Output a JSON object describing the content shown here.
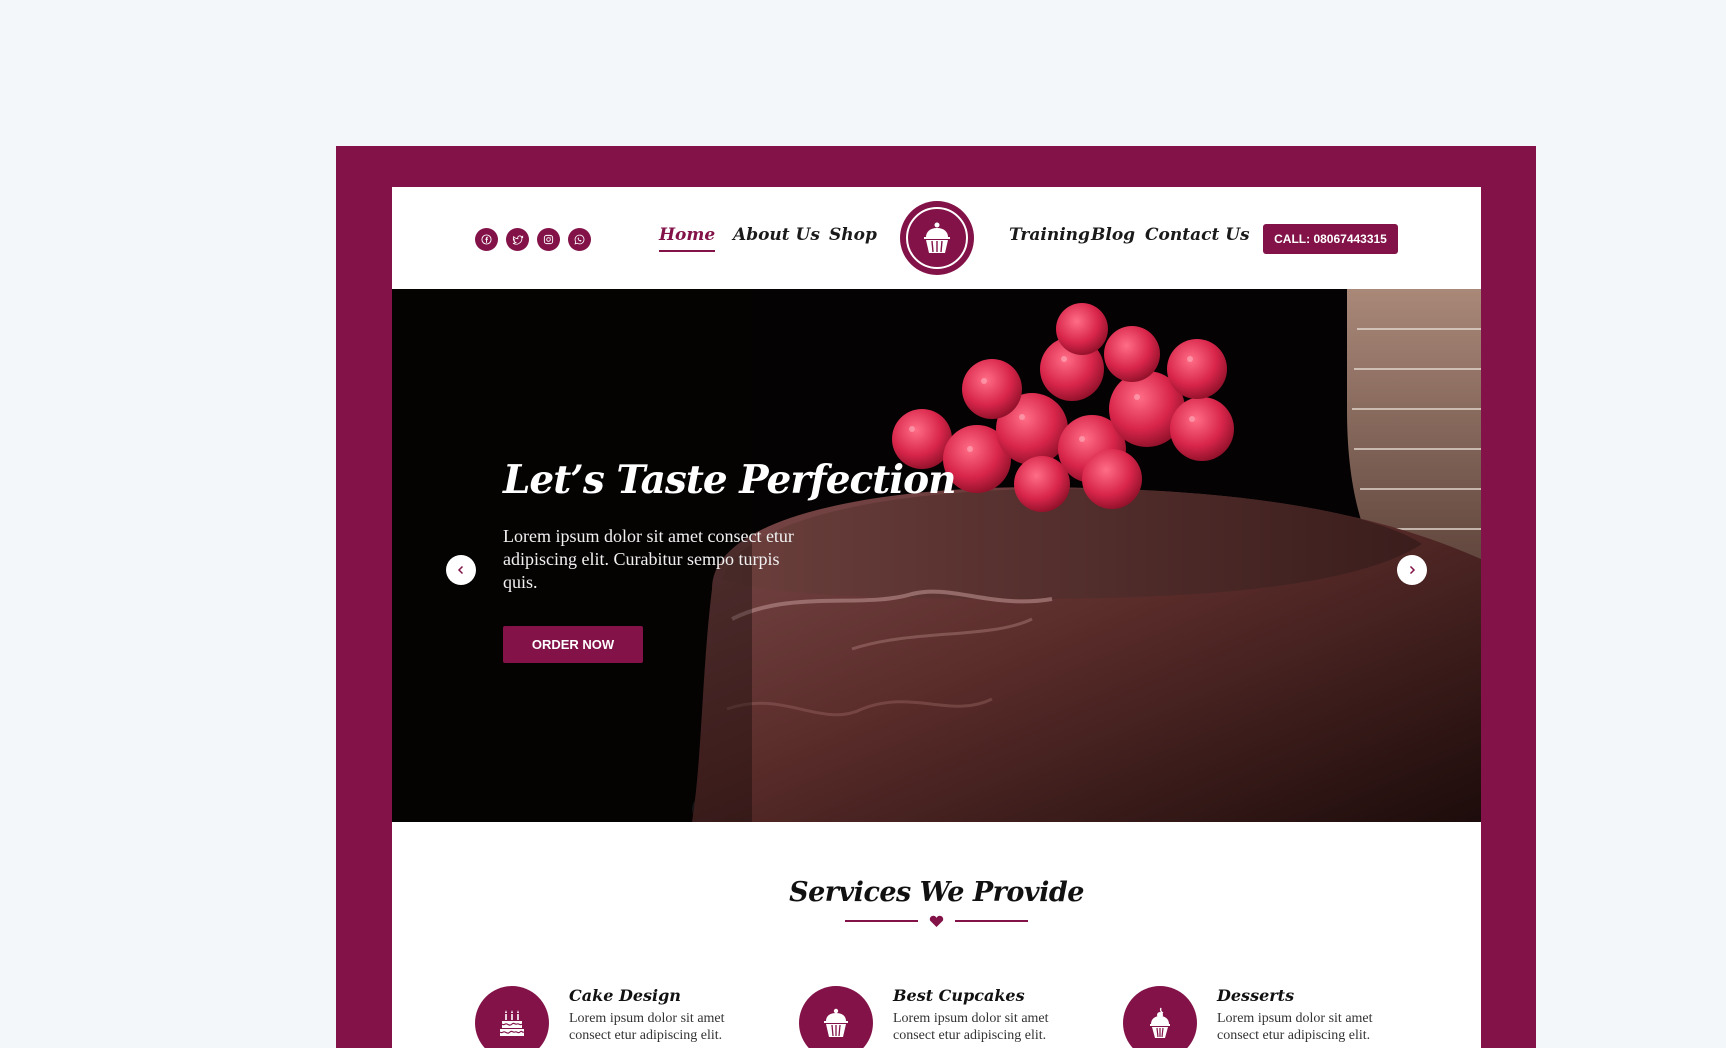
{
  "nav": {
    "social": [
      {
        "icon": "facebook-icon"
      },
      {
        "icon": "twitter-icon"
      },
      {
        "icon": "instagram-icon"
      },
      {
        "icon": "whatsapp-icon"
      }
    ],
    "links": [
      "Home",
      "About Us",
      "Shop",
      "Training",
      "Blog",
      "Contact Us"
    ],
    "active": "Home",
    "logo_icon": "cupcake-logo-icon",
    "call_label": "CALL: 08067443315"
  },
  "hero": {
    "title": "Let’s Taste Perfection",
    "text": "Lorem ipsum dolor sit amet consect etur adipiscing elit. Curabitur sempo turpis quis.",
    "cta": "ORDER NOW"
  },
  "services": {
    "title": "Services We Provide",
    "items": [
      {
        "title": "Cake Design",
        "text": "Lorem ipsum dolor sit amet consect etur adipiscing elit.",
        "icon": "birthday-cake-icon"
      },
      {
        "title": "Best Cupcakes",
        "text": "Lorem ipsum dolor sit amet consect etur adipiscing elit.",
        "icon": "cupcake-icon"
      },
      {
        "title": "Desserts",
        "text": "Lorem ipsum dolor sit amet consect etur adipiscing elit.",
        "icon": "dessert-icon"
      }
    ]
  },
  "colors": {
    "brand": "#821248",
    "background": "#f4f7fa",
    "hero_background": "#050203"
  }
}
